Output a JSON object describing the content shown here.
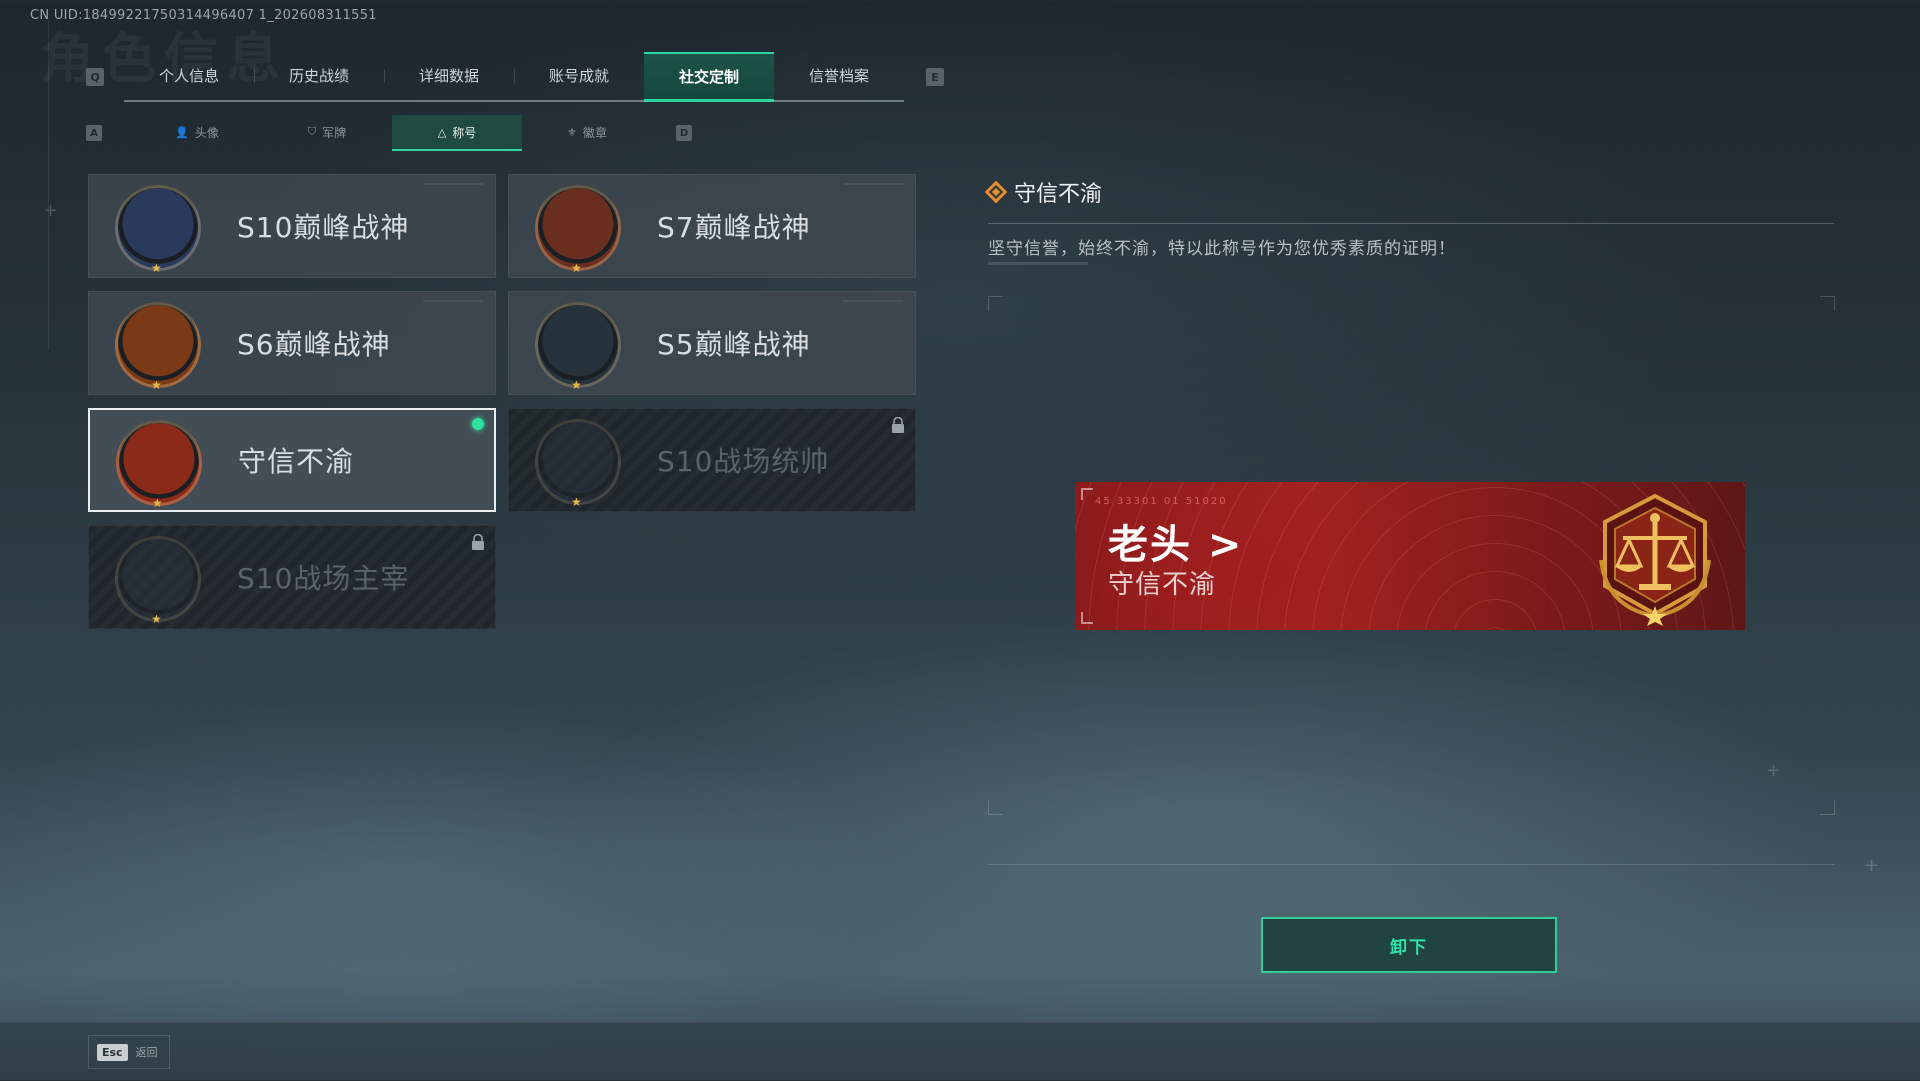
{
  "uid_text": "CN UID:18499221750314496407 1_202608311551",
  "bg_title": "角色信息",
  "main_tabs": {
    "left_key": "Q",
    "right_key": "E",
    "items": [
      "个人信息",
      "历史战绩",
      "详细数据",
      "账号成就",
      "社交定制",
      "信誉档案"
    ],
    "active_index": 4
  },
  "sub_tabs": {
    "left_key": "A",
    "right_key": "D",
    "items": [
      "头像",
      "军牌",
      "称号",
      "徽章"
    ],
    "active_index": 2
  },
  "titles": [
    {
      "name": "S10巅峰战神",
      "locked": false,
      "selected": false,
      "emblem": "s10-peak-emblem",
      "color": "#2a3a5c"
    },
    {
      "name": "S7巅峰战神",
      "locked": false,
      "selected": false,
      "emblem": "s7-peak-emblem",
      "color": "#6a2e1f"
    },
    {
      "name": "S6巅峰战神",
      "locked": false,
      "selected": false,
      "emblem": "s6-peak-emblem",
      "color": "#7a3a16"
    },
    {
      "name": "S5巅峰战神",
      "locked": false,
      "selected": false,
      "emblem": "s5-peak-emblem",
      "color": "#26323c"
    },
    {
      "name": "守信不渝",
      "locked": false,
      "selected": true,
      "equipped": true,
      "emblem": "scales-emblem",
      "color": "#8c2a1a"
    },
    {
      "name": "S10战场统帅",
      "locked": true,
      "selected": false,
      "emblem": "aircraft-emblem",
      "color": "#2a3440"
    },
    {
      "name": "S10战场主宰",
      "locked": true,
      "selected": false,
      "emblem": "colosseum-emblem",
      "color": "#2a3440"
    }
  ],
  "detail": {
    "title": "守信不渝",
    "description": "坚守信誉，始终不渝，特以此称号作为您优秀素质的证明！"
  },
  "banner": {
    "player_name": "老头 >",
    "title": "守信不渝",
    "code": "45 33301 01 51020"
  },
  "unequip_label": "卸下",
  "footer": {
    "esc_key": "Esc",
    "back_label": "返回"
  },
  "colors": {
    "accent": "#2fd6a2",
    "banner_red": "#a3231f",
    "gold": "#e8b64a"
  }
}
